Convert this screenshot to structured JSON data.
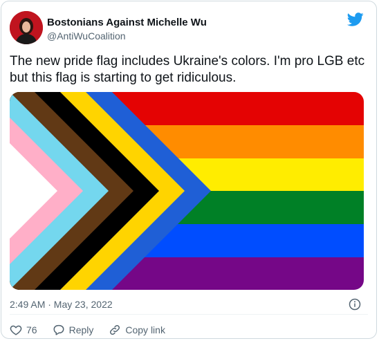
{
  "author": {
    "display_name": "Bostonians Against Michelle Wu",
    "handle": "@AntiWuCoalition"
  },
  "tweet": {
    "text": "The new pride flag includes Ukraine's colors. I'm pro LGB etc but this flag is starting to get ridiculous.",
    "timestamp": "2:49 AM · May 23, 2022"
  },
  "actions": {
    "like_count": "76",
    "reply_label": "Reply",
    "copy_link_label": "Copy link"
  },
  "colors": {
    "brand_blue": "#1d9bf0",
    "muted_text": "#536471",
    "flag_stripes": [
      "#e40303",
      "#ff8c00",
      "#ffed00",
      "#008026",
      "#004dff",
      "#750787"
    ],
    "chevrons_outer_to_inner": [
      "#1f5fd6",
      "#ffd400",
      "#000000",
      "#613915",
      "#74d7ee",
      "#ffafc8",
      "#ffffff"
    ]
  },
  "icons": {
    "brand": "twitter-bird-icon",
    "info": "info-circle-icon",
    "like": "heart-icon",
    "reply": "reply-bubble-icon",
    "copy_link": "link-icon"
  }
}
